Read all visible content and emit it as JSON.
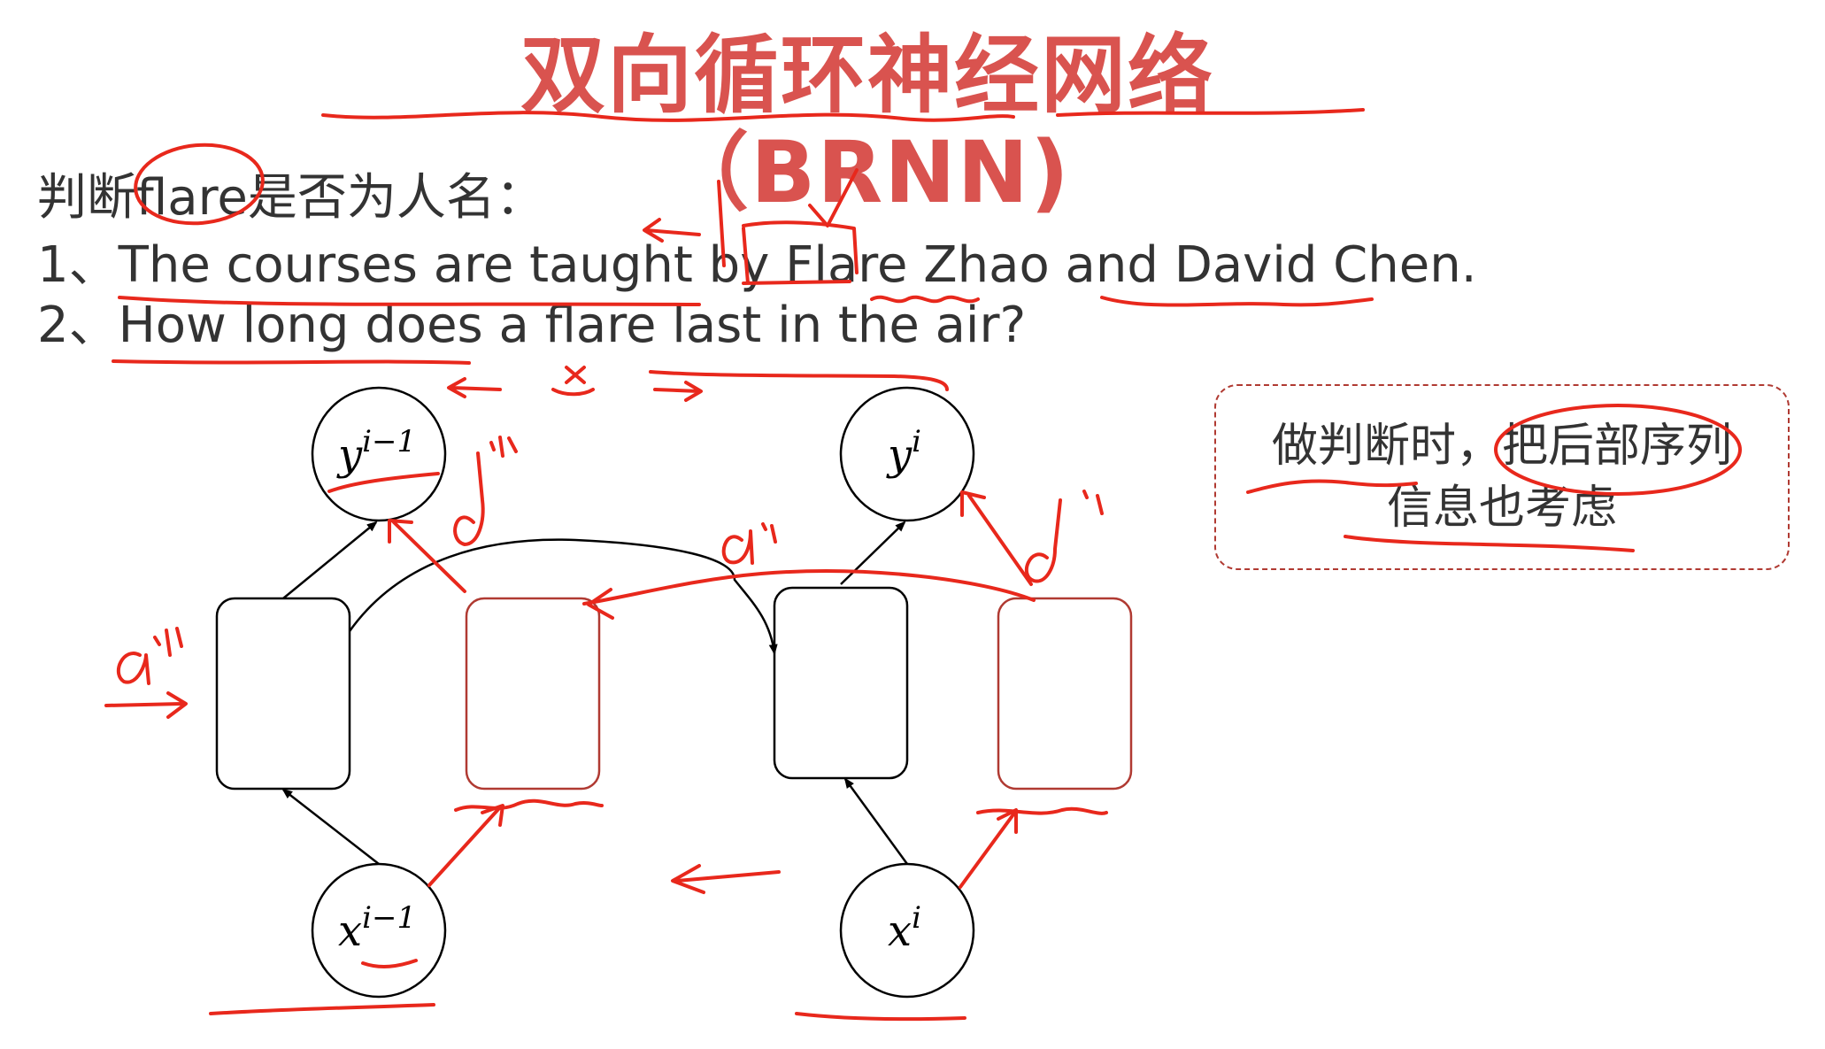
{
  "title": "双向循环神经网络（BRNN)",
  "question": "判断flare是否为人名：",
  "sentences": [
    "1、The courses are taught by Flare Zhao and David Chen.",
    "2、How long does a flare last in the air?"
  ],
  "note": {
    "line1": "做判断时，把后部序列",
    "line2": "信息也考虑"
  },
  "nodes": {
    "y_prev_base": "y",
    "y_prev_sup": "i−1",
    "y_cur_base": "y",
    "y_cur_sup": "i",
    "x_prev_base": "x",
    "x_prev_sup": "i−1",
    "x_cur_base": "x",
    "x_cur_sup": "i"
  },
  "annotations": {
    "a_prev_left": "a",
    "a_prev_left_sup": "i-1",
    "a_prev_top": "a",
    "a_prev_top_sup": "i-1",
    "a_cur_mid": "a",
    "a_cur_mid_sup": "i",
    "a_cur_right": "a",
    "a_cur_right_sup": "i",
    "x_mark": "x",
    "check": "✓"
  },
  "colors": {
    "title": "#d9534f",
    "ink": "#e8281c",
    "text": "#333333",
    "box_red": "#b03a32"
  }
}
